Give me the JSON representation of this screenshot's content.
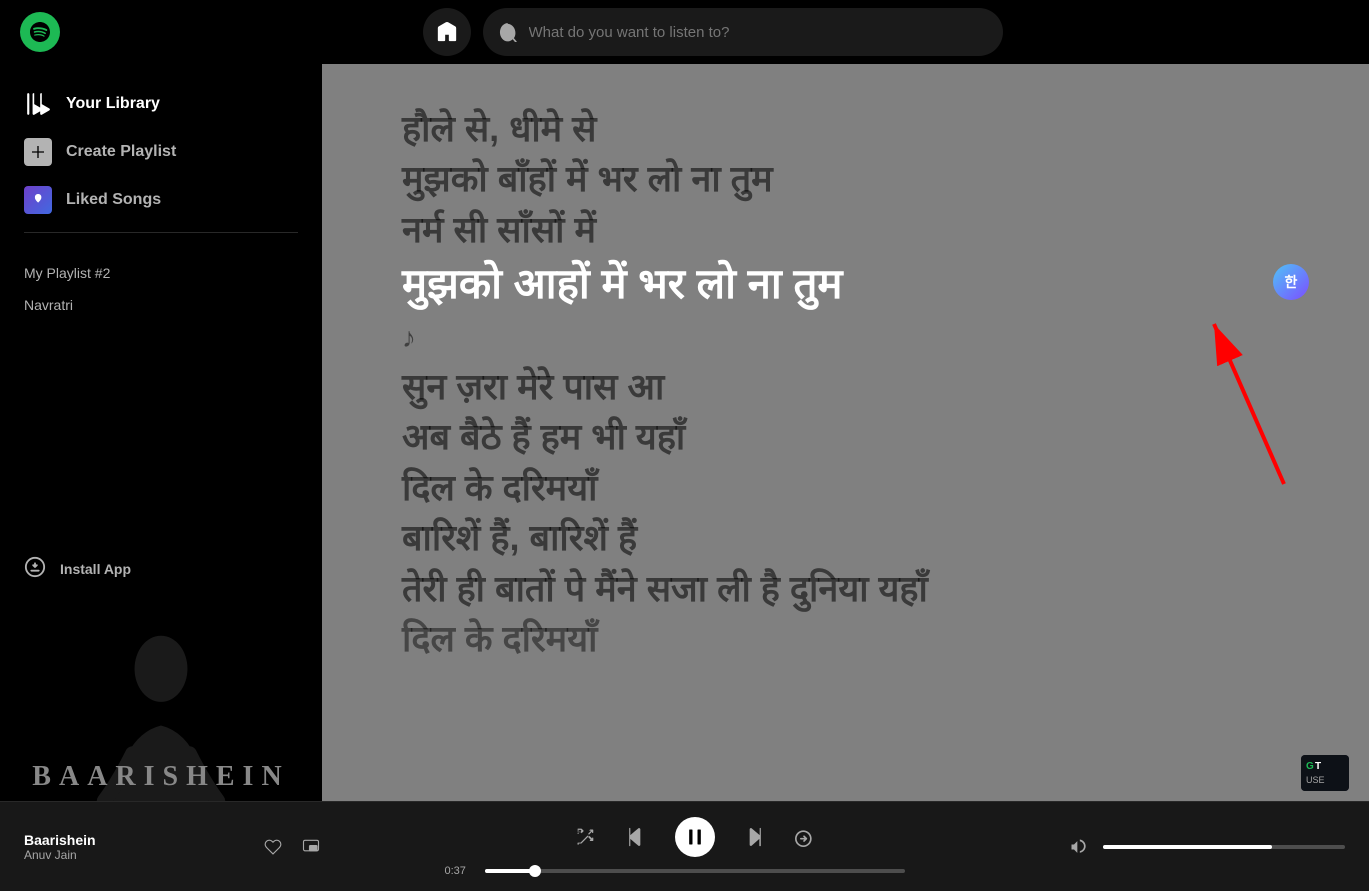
{
  "topbar": {
    "search_placeholder": "What do you want to listen to?"
  },
  "sidebar": {
    "library_label": "Your Library",
    "create_playlist_label": "Create Playlist",
    "liked_songs_label": "Liked Songs",
    "playlists": [
      {
        "name": "My Playlist #2"
      },
      {
        "name": "Navratri"
      }
    ],
    "install_app_label": "Install App",
    "album_title": "BAARISHEIN"
  },
  "lyrics": {
    "line1": "हौले से, धीमे से",
    "line2": "मुझको बाँहों में भर लो ना तुम",
    "line3": "नर्म सी साँसों में",
    "line4_active": "मुझको आहों में भर लो ना तुम",
    "note": "♪",
    "line5": "सुन ज़रा मेरे पास आ",
    "line6": "अब बैठे हैं हम भी यहाँ",
    "line7": "दिल के दरिमयाँ",
    "line8": "बारिशें हैं, बारिशें हैं",
    "line9": "तेरी ही बातों पे मैंने सजा ली है दुनिया यहाँ",
    "line10": "दिल के दरिमयाँ"
  },
  "translation_icon_text": "한",
  "player": {
    "track_name": "Baarishein",
    "artist_name": "Anuv Jain",
    "time_current": "0:37",
    "time_total": "",
    "shuffle_label": "Shuffle",
    "prev_label": "Previous",
    "pause_label": "Pause",
    "next_label": "Next",
    "repeat_label": "Repeat"
  }
}
